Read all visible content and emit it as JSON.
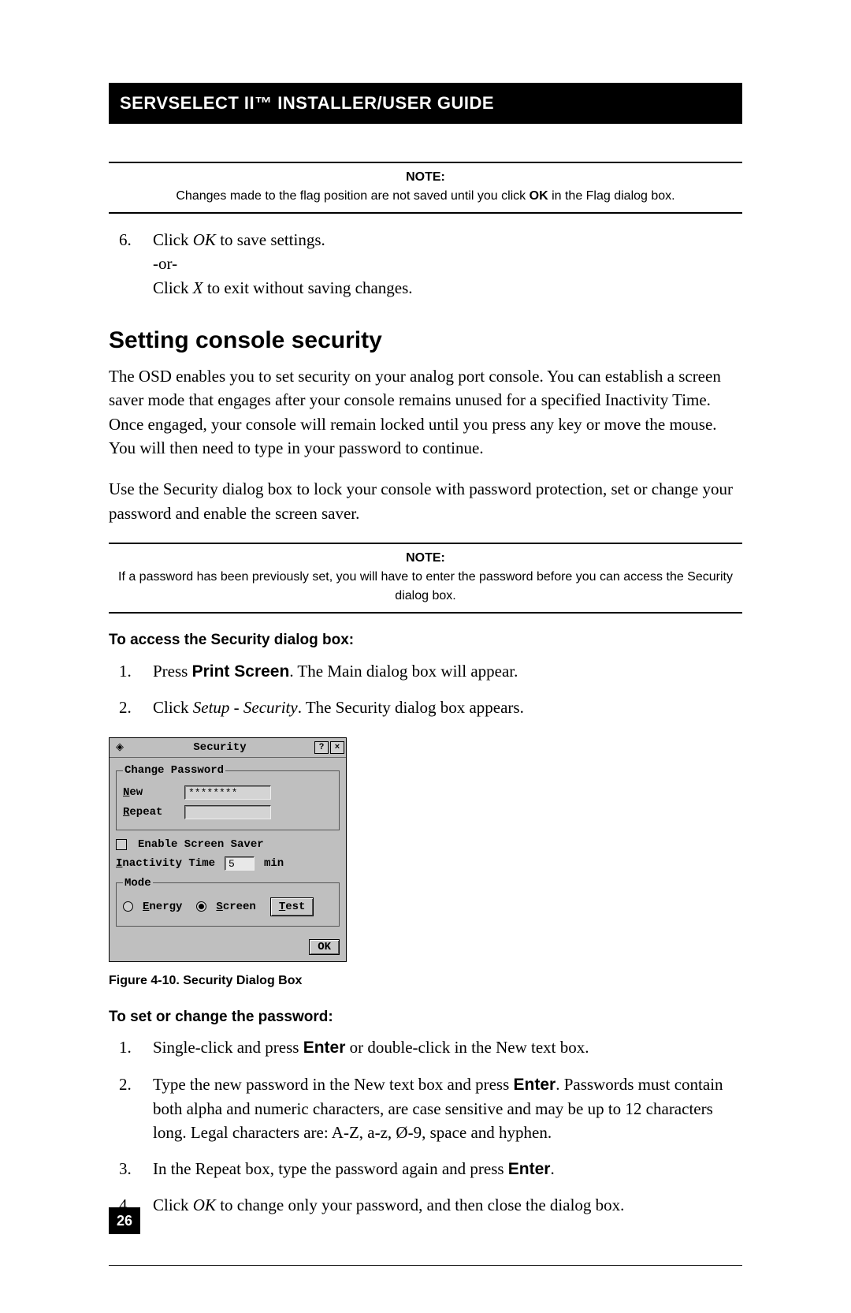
{
  "header": "SERVSELECT II™ INSTALLER/USER GUIDE",
  "note1": {
    "title": "NOTE:",
    "body_a": "Changes made to the flag position are not saved until you click ",
    "body_bold": "OK",
    "body_b": " in the Flag dialog box."
  },
  "step6": {
    "line1_a": "Click ",
    "line1_it": "OK",
    "line1_b": " to save settings.",
    "line2": "-or-",
    "line3_a": "Click ",
    "line3_it": "X",
    "line3_b": " to exit without saving changes."
  },
  "section_heading": "Setting console security",
  "para1": "The OSD enables you to set security on your analog port console. You can establish a screen saver mode that engages after your console remains unused for a specified Inactivity Time. Once engaged, your console will remain locked until you press any key or move the mouse. You will then need to type in your password to continue.",
  "para2": "Use the Security dialog box to lock your console with password protection, set or change your password and enable the screen saver.",
  "note2": {
    "title": "NOTE:",
    "body": "If a password has been previously set, you will have to enter the password before you can access the Security dialog box."
  },
  "sub1": "To access the Security dialog box:",
  "accessSteps": {
    "s1_a": "Press ",
    "s1_bold": "Print Screen",
    "s1_b": ". The Main dialog box will appear.",
    "s2_a": "Click ",
    "s2_it": "Setup - Security",
    "s2_b": ". The Security dialog box appears."
  },
  "dialog": {
    "title": "Security",
    "help_btn": "?",
    "close_btn": "×",
    "group_pw": "Change Password",
    "lbl_new_hot": "N",
    "lbl_new_rest": "ew",
    "pw_value": "********",
    "lbl_repeat_hot": "R",
    "lbl_repeat_rest": "epeat",
    "chk_label": "Enable Screen Saver",
    "inact_hot": "I",
    "inact_rest": "nactivity Time",
    "inact_value": "5",
    "inact_unit": "min",
    "group_mode": "Mode",
    "energy_hot": "E",
    "energy_rest": "nergy",
    "screen_hot": "S",
    "screen_rest": "creen",
    "test_hot": "T",
    "test_rest": "est",
    "ok_btn": "OK"
  },
  "caption": "Figure 4-10. Security Dialog Box",
  "sub2": "To set or change the password:",
  "pwSteps": {
    "s1_a": "Single-click and press ",
    "s1_bold": "Enter",
    "s1_b": " or double-click in the New text box.",
    "s2_a": "Type the new password in the New text box and press ",
    "s2_bold": "Enter",
    "s2_b": ". Passwords must contain both alpha and numeric characters, are case sensitive and may be up to 12 characters long. Legal characters are: A-Z, a-z, Ø-9, space and hyphen.",
    "s3_a": "In the Repeat box, type the password again and press ",
    "s3_bold": "Enter",
    "s3_b": ".",
    "s4_a": "Click ",
    "s4_it": "OK",
    "s4_b": " to change only your password, and then close the dialog box."
  },
  "page_num": "26"
}
